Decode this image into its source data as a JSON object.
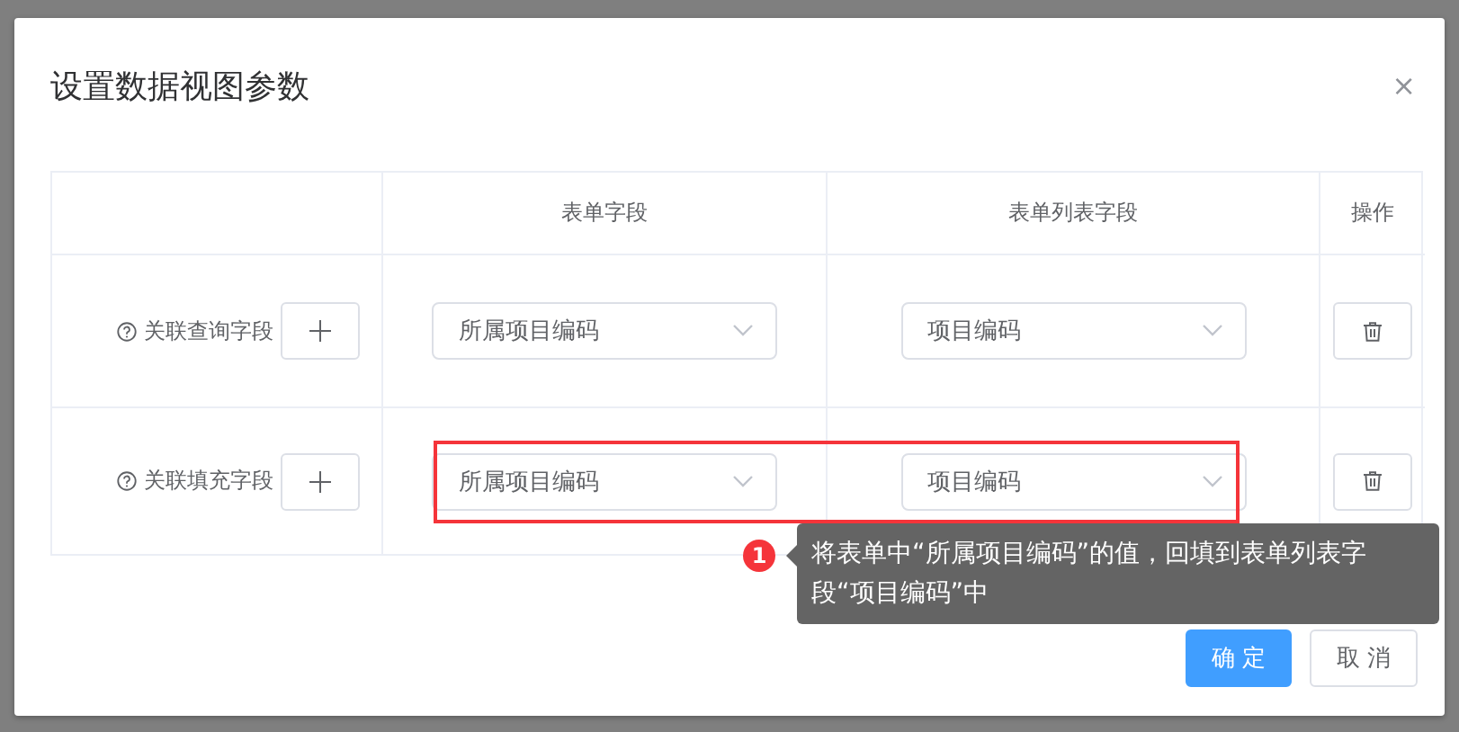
{
  "dialog": {
    "title": "设置数据视图参数",
    "close": "×"
  },
  "table": {
    "columns": [
      "表单字段",
      "表单列表字段",
      "操作"
    ],
    "rows": [
      {
        "label": "关联查询字段",
        "form_field": "所属项目编码",
        "list_field": "项目编码",
        "highlighted": false
      },
      {
        "label": "关联填充字段",
        "form_field": "所属项目编码",
        "list_field": "项目编码",
        "highlighted": true
      }
    ]
  },
  "annotation": {
    "badge": "1",
    "text": "将表单中“所属项目编码”的值，回填到表单列表字段“项目编码”中"
  },
  "buttons": [
    {
      "label": "确 定",
      "kind": "primary"
    },
    {
      "label": "取 消",
      "kind": "default"
    }
  ]
}
